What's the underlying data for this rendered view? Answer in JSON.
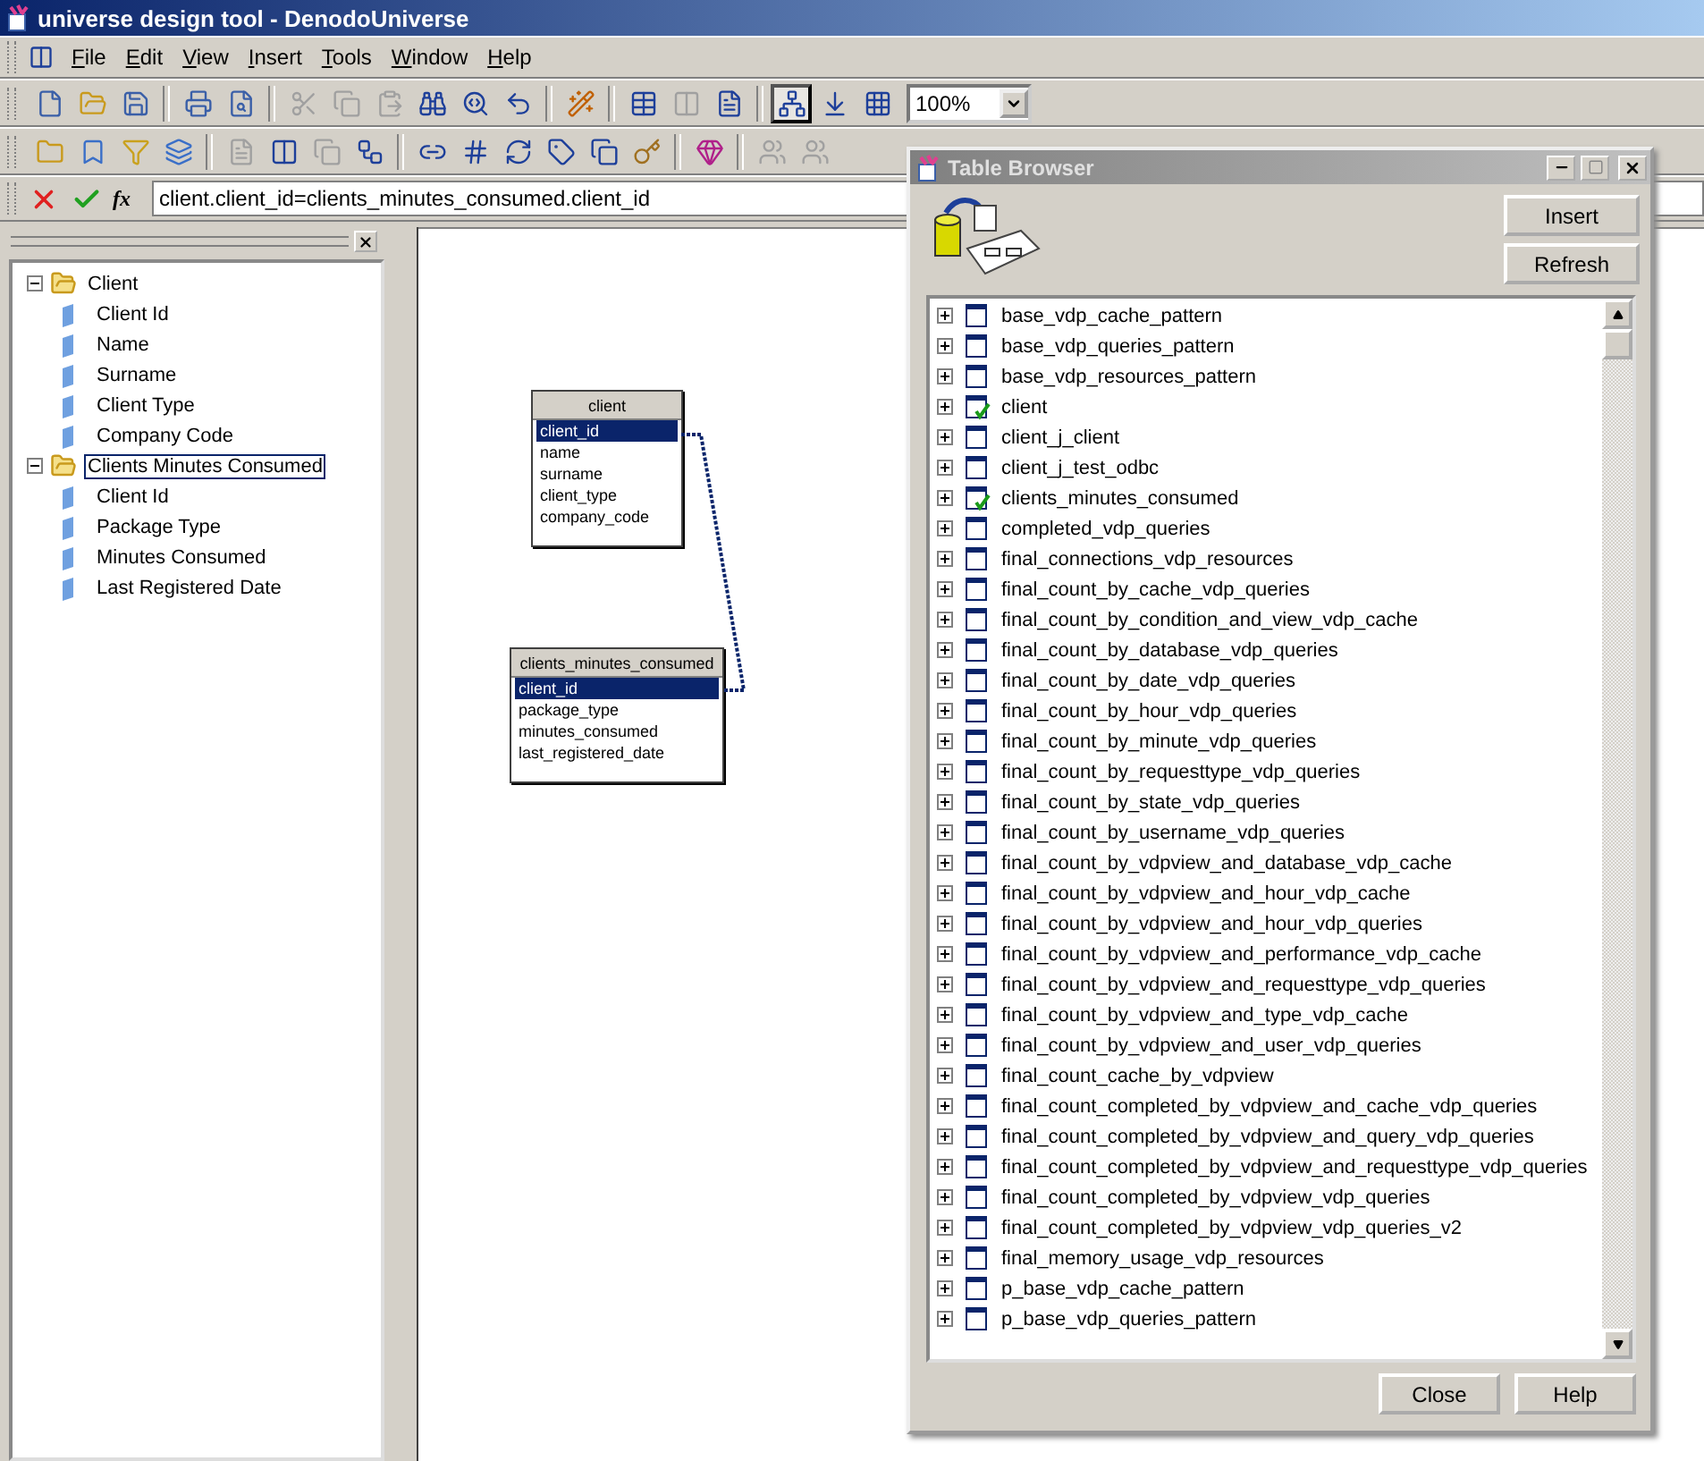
{
  "window": {
    "title": "universe design tool - DenodoUniverse"
  },
  "menu": [
    "File",
    "Edit",
    "View",
    "Insert",
    "Tools",
    "Window",
    "Help"
  ],
  "toolbars": [
    [
      {
        "kind": "new",
        "disabled": false,
        "pressed": false
      },
      {
        "kind": "open",
        "disabled": false,
        "pressed": false
      },
      {
        "kind": "save",
        "disabled": false,
        "pressed": false
      },
      {
        "kind": "sep"
      },
      {
        "kind": "print",
        "disabled": false,
        "pressed": false
      },
      {
        "kind": "preview",
        "disabled": false,
        "pressed": false
      },
      {
        "kind": "sep"
      },
      {
        "kind": "cut",
        "disabled": true,
        "pressed": false
      },
      {
        "kind": "copy",
        "disabled": true,
        "pressed": false
      },
      {
        "kind": "paste",
        "disabled": true,
        "pressed": false
      },
      {
        "kind": "find",
        "disabled": false,
        "pressed": false
      },
      {
        "kind": "findnext",
        "disabled": false,
        "pressed": false
      },
      {
        "kind": "undo",
        "disabled": false,
        "pressed": false
      },
      {
        "kind": "sep"
      },
      {
        "kind": "wizard",
        "disabled": false,
        "pressed": false
      },
      {
        "kind": "sep"
      },
      {
        "kind": "table",
        "disabled": false,
        "pressed": false
      },
      {
        "kind": "columns",
        "disabled": true,
        "pressed": false
      },
      {
        "kind": "detail",
        "disabled": false,
        "pressed": false
      },
      {
        "kind": "sep"
      },
      {
        "kind": "structure",
        "disabled": false,
        "pressed": true
      },
      {
        "kind": "arrange",
        "disabled": false,
        "pressed": false
      },
      {
        "kind": "grid",
        "disabled": false,
        "pressed": false
      }
    ],
    [
      {
        "kind": "folder",
        "disabled": false,
        "pressed": false
      },
      {
        "kind": "object",
        "disabled": false,
        "pressed": false
      },
      {
        "kind": "filter",
        "disabled": false,
        "pressed": false
      },
      {
        "kind": "stack",
        "disabled": false,
        "pressed": false
      },
      {
        "kind": "sep"
      },
      {
        "kind": "detail",
        "disabled": true,
        "pressed": false
      },
      {
        "kind": "columns",
        "disabled": false,
        "pressed": false
      },
      {
        "kind": "copy",
        "disabled": true,
        "pressed": false
      },
      {
        "kind": "hierarchy",
        "disabled": false,
        "pressed": false
      },
      {
        "kind": "sep"
      },
      {
        "kind": "join",
        "disabled": false,
        "pressed": false
      },
      {
        "kind": "cardinality",
        "disabled": false,
        "pressed": false
      },
      {
        "kind": "loop",
        "disabled": false,
        "pressed": false
      },
      {
        "kind": "context",
        "disabled": false,
        "pressed": false
      },
      {
        "kind": "alias",
        "disabled": false,
        "pressed": false
      },
      {
        "kind": "key",
        "disabled": false,
        "pressed": false
      },
      {
        "kind": "sep"
      },
      {
        "kind": "check",
        "disabled": false,
        "pressed": false
      },
      {
        "kind": "sep"
      },
      {
        "kind": "users",
        "disabled": true,
        "pressed": false
      },
      {
        "kind": "users",
        "disabled": true,
        "pressed": false
      }
    ]
  ],
  "zoom": {
    "value": "100%"
  },
  "formula": {
    "function_label": "fx",
    "value": "client.client_id=clients_minutes_consumed.client_id"
  },
  "tree": [
    {
      "label": "Client",
      "expanded": true,
      "selected": false,
      "children": [
        {
          "label": "Client Id"
        },
        {
          "label": "Name"
        },
        {
          "label": "Surname"
        },
        {
          "label": "Client Type"
        },
        {
          "label": "Company Code"
        }
      ]
    },
    {
      "label": "Clients Minutes Consumed",
      "expanded": true,
      "selected": true,
      "children": [
        {
          "label": "Client Id"
        },
        {
          "label": "Package Type"
        },
        {
          "label": "Minutes Consumed"
        },
        {
          "label": "Last Registered Date"
        }
      ]
    }
  ],
  "diagram": {
    "tables": [
      {
        "name": "client",
        "columns": [
          {
            "name": "client_id",
            "selected": true
          },
          {
            "name": "name",
            "selected": false
          },
          {
            "name": "surname",
            "selected": false
          },
          {
            "name": "client_type",
            "selected": false
          },
          {
            "name": "company_code",
            "selected": false
          }
        ]
      },
      {
        "name": "clients_minutes_consumed",
        "columns": [
          {
            "name": "client_id",
            "selected": true
          },
          {
            "name": "package_type",
            "selected": false
          },
          {
            "name": "minutes_consumed",
            "selected": false
          },
          {
            "name": "last_registered_date",
            "selected": false
          }
        ]
      }
    ]
  },
  "table_browser": {
    "title": "Table Browser",
    "buttons": [
      "Insert",
      "Refresh"
    ],
    "footer_buttons": [
      "Close",
      "Help"
    ],
    "tables": [
      {
        "name": "base_vdp_cache_pattern",
        "checked": false
      },
      {
        "name": "base_vdp_queries_pattern",
        "checked": false
      },
      {
        "name": "base_vdp_resources_pattern",
        "checked": false
      },
      {
        "name": "client",
        "checked": true
      },
      {
        "name": "client_j_client",
        "checked": false
      },
      {
        "name": "client_j_test_odbc",
        "checked": false
      },
      {
        "name": "clients_minutes_consumed",
        "checked": true
      },
      {
        "name": "completed_vdp_queries",
        "checked": false
      },
      {
        "name": "final_connections_vdp_resources",
        "checked": false
      },
      {
        "name": "final_count_by_cache_vdp_queries",
        "checked": false
      },
      {
        "name": "final_count_by_condition_and_view_vdp_cache",
        "checked": false
      },
      {
        "name": "final_count_by_database_vdp_queries",
        "checked": false
      },
      {
        "name": "final_count_by_date_vdp_queries",
        "checked": false
      },
      {
        "name": "final_count_by_hour_vdp_queries",
        "checked": false
      },
      {
        "name": "final_count_by_minute_vdp_queries",
        "checked": false
      },
      {
        "name": "final_count_by_requesttype_vdp_queries",
        "checked": false
      },
      {
        "name": "final_count_by_state_vdp_queries",
        "checked": false
      },
      {
        "name": "final_count_by_username_vdp_queries",
        "checked": false
      },
      {
        "name": "final_count_by_vdpview_and_database_vdp_cache",
        "checked": false
      },
      {
        "name": "final_count_by_vdpview_and_hour_vdp_cache",
        "checked": false
      },
      {
        "name": "final_count_by_vdpview_and_hour_vdp_queries",
        "checked": false
      },
      {
        "name": "final_count_by_vdpview_and_performance_vdp_cache",
        "checked": false
      },
      {
        "name": "final_count_by_vdpview_and_requesttype_vdp_queries",
        "checked": false
      },
      {
        "name": "final_count_by_vdpview_and_type_vdp_cache",
        "checked": false
      },
      {
        "name": "final_count_by_vdpview_and_user_vdp_queries",
        "checked": false
      },
      {
        "name": "final_count_cache_by_vdpview",
        "checked": false
      },
      {
        "name": "final_count_completed_by_vdpview_and_cache_vdp_queries",
        "checked": false
      },
      {
        "name": "final_count_completed_by_vdpview_and_query_vdp_queries",
        "checked": false
      },
      {
        "name": "final_count_completed_by_vdpview_and_requesttype_vdp_queries",
        "checked": false
      },
      {
        "name": "final_count_completed_by_vdpview_vdp_queries",
        "checked": false
      },
      {
        "name": "final_count_completed_by_vdpview_vdp_queries_v2",
        "checked": false
      },
      {
        "name": "final_memory_usage_vdp_resources",
        "checked": false
      },
      {
        "name": "p_base_vdp_cache_pattern",
        "checked": false
      },
      {
        "name": "p_base_vdp_queries_pattern",
        "checked": false
      }
    ]
  }
}
